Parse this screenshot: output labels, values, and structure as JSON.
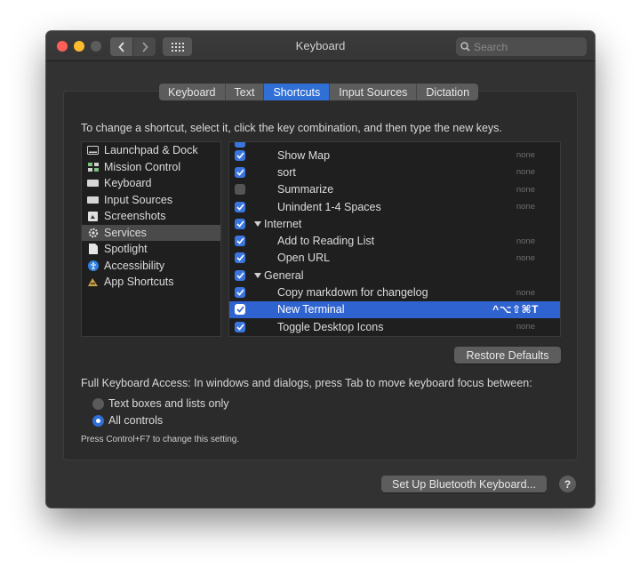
{
  "window": {
    "title": "Keyboard"
  },
  "search": {
    "placeholder": "Search"
  },
  "tabs": [
    {
      "label": "Keyboard",
      "active": false
    },
    {
      "label": "Text",
      "active": false
    },
    {
      "label": "Shortcuts",
      "active": true
    },
    {
      "label": "Input Sources",
      "active": false
    },
    {
      "label": "Dictation",
      "active": false
    }
  ],
  "instructions": "To change a shortcut, select it, click the key combination, and then type the new keys.",
  "categories": [
    {
      "label": "Launchpad & Dock",
      "icon": "launchpad-dock-icon"
    },
    {
      "label": "Mission Control",
      "icon": "mission-control-icon"
    },
    {
      "label": "Keyboard",
      "icon": "keyboard-icon"
    },
    {
      "label": "Input Sources",
      "icon": "input-sources-icon"
    },
    {
      "label": "Screenshots",
      "icon": "screenshots-icon"
    },
    {
      "label": "Services",
      "icon": "gear-icon",
      "selected": true
    },
    {
      "label": "Spotlight",
      "icon": "spotlight-icon"
    },
    {
      "label": "Accessibility",
      "icon": "accessibility-icon"
    },
    {
      "label": "App Shortcuts",
      "icon": "app-shortcuts-icon"
    }
  ],
  "shortcuts": [
    {
      "label": "Show Map",
      "key": "none",
      "checked": true
    },
    {
      "label": "sort",
      "key": "none",
      "checked": true
    },
    {
      "label": "Summarize",
      "key": "none",
      "checked": false
    },
    {
      "label": "Unindent 1-4 Spaces",
      "key": "none",
      "checked": true
    },
    {
      "label": "Internet",
      "group": true,
      "checked": true
    },
    {
      "label": "Add to Reading List",
      "key": "none",
      "checked": true
    },
    {
      "label": "Open URL",
      "key": "none",
      "checked": true
    },
    {
      "label": "General",
      "group": true,
      "checked": true
    },
    {
      "label": "Copy markdown for changelog",
      "key": "none",
      "checked": true
    },
    {
      "label": "New Terminal",
      "key": "^⌥⇧⌘T",
      "checked": true,
      "selected": true
    },
    {
      "label": "Toggle Desktop Icons",
      "key": "none",
      "checked": true
    }
  ],
  "buttons": {
    "restore_defaults": "Restore Defaults",
    "bluetooth": "Set Up Bluetooth Keyboard...",
    "help": "?"
  },
  "full_keyboard_access": {
    "label": "Full Keyboard Access: In windows and dialogs, press Tab to move keyboard focus between:",
    "options": [
      {
        "label": "Text boxes and lists only",
        "selected": false
      },
      {
        "label": "All controls",
        "selected": true
      }
    ],
    "hint": "Press Control+F7 to change this setting."
  }
}
